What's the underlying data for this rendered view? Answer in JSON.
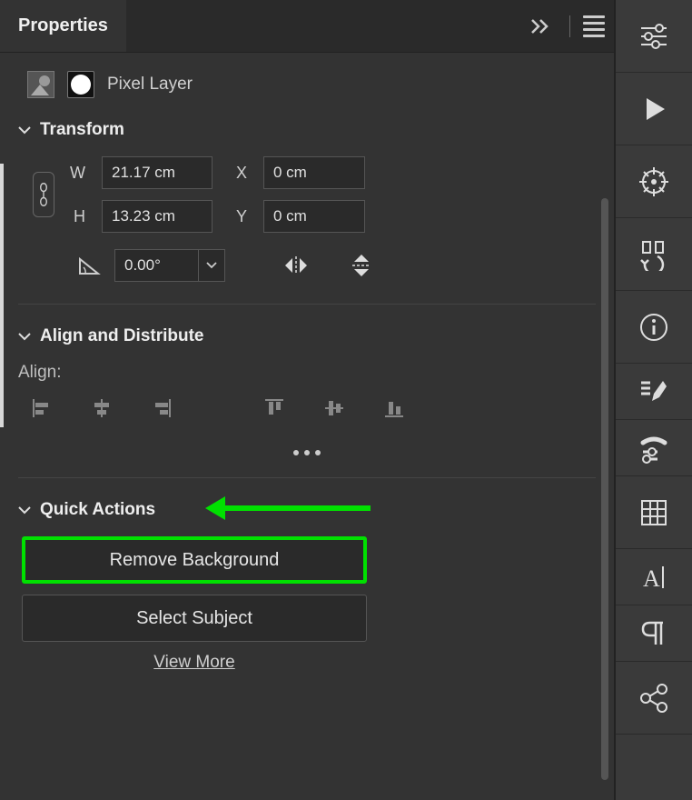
{
  "panel": {
    "title": "Properties",
    "layer_type": "Pixel Layer"
  },
  "transform": {
    "header": "Transform",
    "w_label": "W",
    "h_label": "H",
    "x_label": "X",
    "y_label": "Y",
    "width": "21.17 cm",
    "height": "13.23 cm",
    "x": "0 cm",
    "y": "0 cm",
    "rotation": "0.00°"
  },
  "align": {
    "header": "Align and Distribute",
    "label": "Align:"
  },
  "quick_actions": {
    "header": "Quick Actions",
    "remove_bg": "Remove Background",
    "select_subject": "Select Subject",
    "view_more": "View More"
  },
  "annotation": {
    "highlight_color": "#00e000"
  }
}
